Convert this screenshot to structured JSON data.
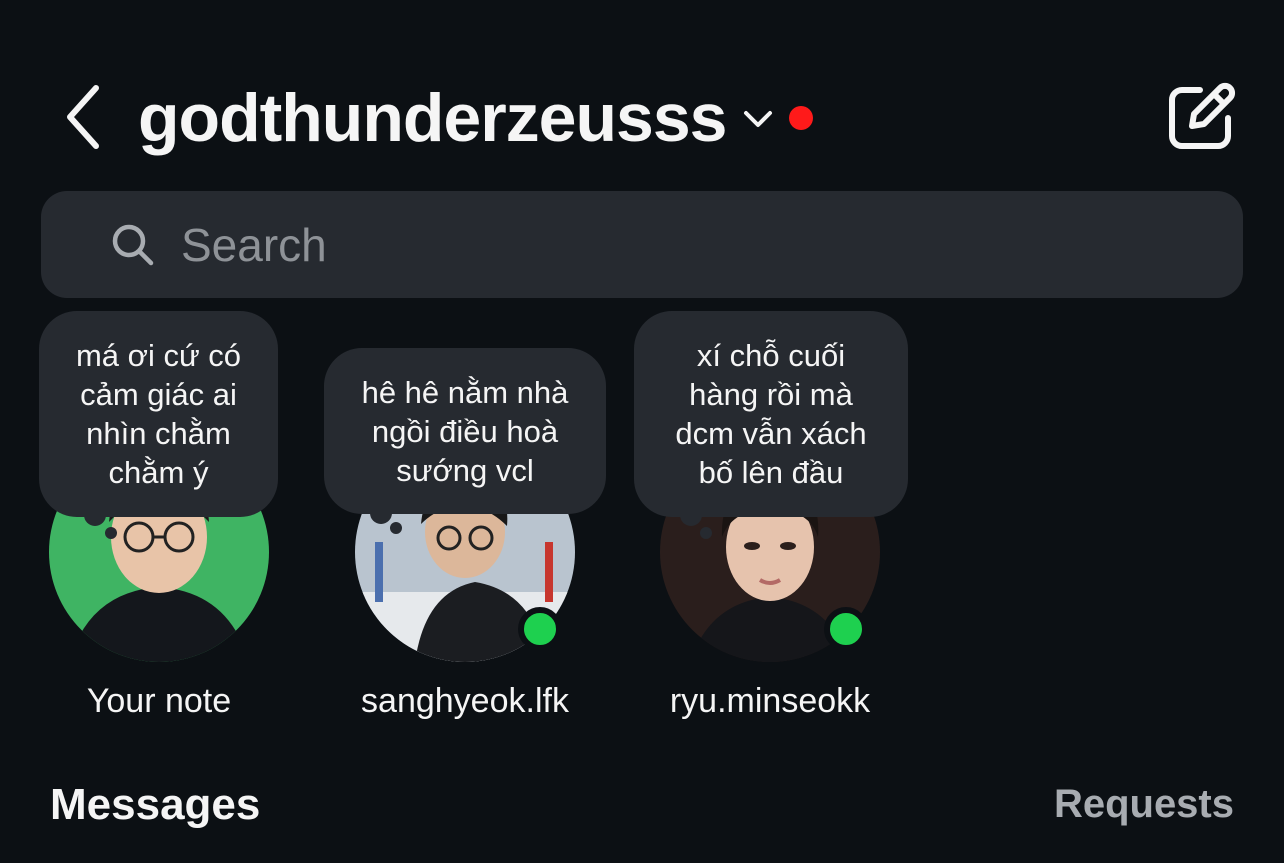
{
  "header": {
    "back_icon": "chevron-left-icon",
    "account_name": "godthunderzeusss",
    "switch_icon": "chevron-down-icon",
    "notification_dot_color": "#ff1a1a",
    "compose_icon": "new-message-icon"
  },
  "search": {
    "icon": "search-icon",
    "placeholder": "Search",
    "value": ""
  },
  "notes": [
    {
      "text": "má ơi cứ có\ncảm giác ai\nnhìn chằm\nchằm ý",
      "name": "Your note",
      "online": false
    },
    {
      "text": "hê hê nằm nhà\nngồi điều hoà\nsướng vcl",
      "name": "sanghyeok.lfk",
      "online": true
    },
    {
      "text": "xí chỗ cuối\nhàng rồi mà\ndcm vẫn xách\nbố lên đầu",
      "name": "ryu.minseokk",
      "online": true
    }
  ],
  "section": {
    "messages_label": "Messages",
    "requests_label": "Requests"
  },
  "colors": {
    "background": "#0c1014",
    "surface": "#262a30",
    "online": "#1ed04f",
    "muted_text": "#a8acb1"
  }
}
